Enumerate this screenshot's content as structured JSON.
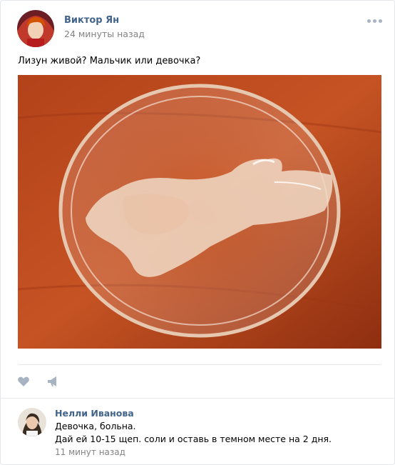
{
  "post": {
    "author": "Виктор Ян",
    "time": "24 минуты назад",
    "text": "Лизун живой? Мальчик или девочка?"
  },
  "comment": {
    "author": "Нелли Иванова",
    "line1": "Девочка, больна.",
    "line2": "Дай ей 10-15 щеп. соли и оставь в темном месте на 2 дня.",
    "time": "11 минут назад"
  },
  "icons": {
    "menu": "more-dots-icon",
    "like": "heart-icon",
    "share": "megaphone-icon"
  },
  "colors": {
    "link": "#42648b",
    "muted": "#828282",
    "icon": "#a8b3c1"
  }
}
